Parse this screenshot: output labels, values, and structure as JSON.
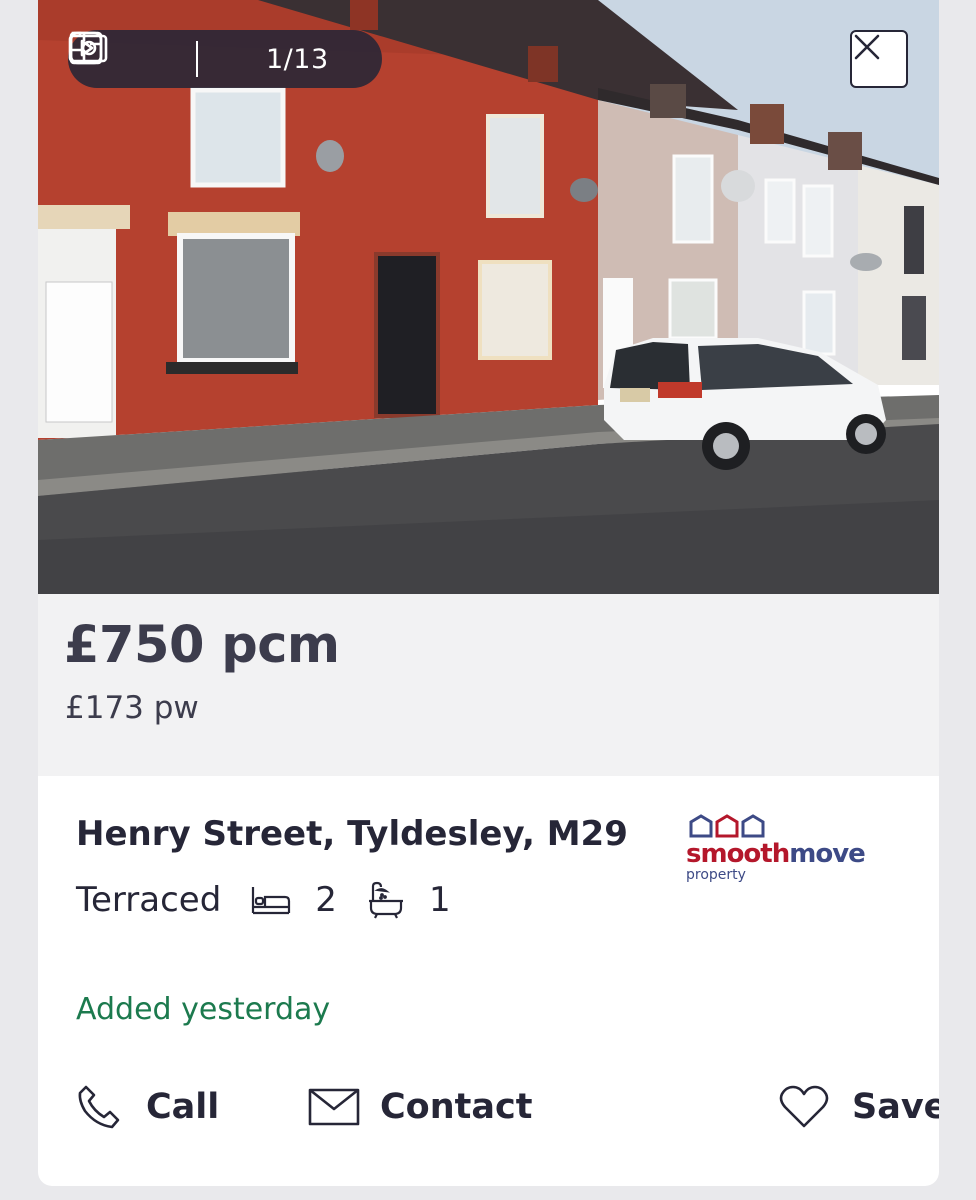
{
  "media": {
    "photo_counter": "1/13",
    "floorplan_icon": "floorplan-icon",
    "video_icon": "play-icon",
    "camera_icon": "camera-icon",
    "close_icon": "close-icon"
  },
  "price": {
    "monthly": "£750 pcm",
    "weekly": "£173 pw"
  },
  "property": {
    "address": "Henry Street, Tyldesley, M29",
    "type": "Terraced",
    "bedrooms": "2",
    "bathrooms": "1",
    "bed_icon": "bed-icon",
    "bath_icon": "bath-icon"
  },
  "agent": {
    "brand_red": "smooth",
    "brand_blue": "move",
    "sub": "property"
  },
  "listing": {
    "added": "Added yesterday"
  },
  "actions": {
    "call": "Call",
    "contact": "Contact",
    "save": "Save"
  },
  "colors": {
    "text": "#262637",
    "added_green": "#1c7a4e",
    "price_band": "#f2f2f3",
    "brand_red": "#b4172b",
    "brand_blue": "#3d4a86"
  }
}
